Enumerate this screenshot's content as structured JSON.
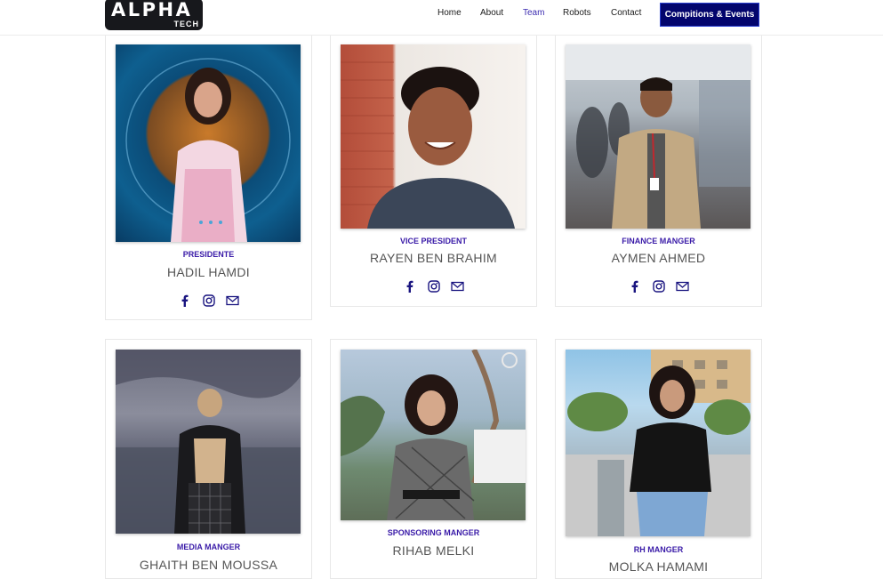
{
  "brand": {
    "logo_main": "ALPHA",
    "logo_sub": "TECH"
  },
  "nav": {
    "items": [
      {
        "label": "Home"
      },
      {
        "label": "About"
      },
      {
        "label": "Team",
        "active": true
      },
      {
        "label": "Robots"
      },
      {
        "label": "Contact"
      }
    ],
    "cta_label": "Compitions & Events"
  },
  "colors": {
    "accent": "#03056d",
    "role": "#3a1ba8",
    "name": "#555555",
    "active_nav": "#3b2bb0"
  },
  "team": [
    {
      "role": "PRESIDENTE",
      "name": "HADIL HAMDI",
      "socials": [
        "facebook-icon",
        "instagram-icon",
        "mail-icon"
      ]
    },
    {
      "role": "VICE PRESIDENT",
      "name": "RAYEN BEN BRAHIM",
      "socials": [
        "facebook-icon",
        "instagram-icon",
        "mail-icon"
      ]
    },
    {
      "role": "FINANCE MANGER",
      "name": "AYMEN AHMED",
      "socials": [
        "facebook-icon",
        "instagram-icon",
        "mail-icon"
      ]
    },
    {
      "role": "MEDIA MANGER",
      "name": "GHAITH BEN MOUSSA"
    },
    {
      "role": "SPONSORING MANGER",
      "name": "RIHAB MELKI"
    },
    {
      "role": "RH MANGER",
      "name": "MOLKA HAMAMI"
    }
  ]
}
